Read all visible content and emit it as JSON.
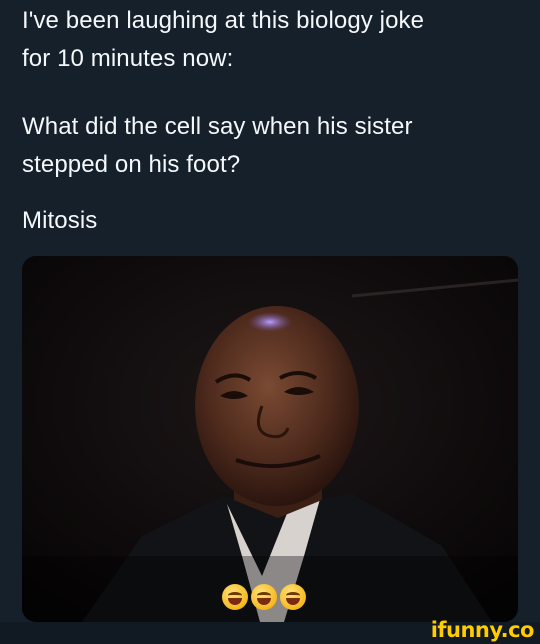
{
  "tweet": {
    "paragraphs": [
      [
        "I've been laughing at this biology joke",
        "for 10 minutes now:"
      ],
      [
        "What did the cell say when his sister",
        "stepped on his foot?"
      ],
      [
        "Mitosis"
      ]
    ]
  },
  "media": {
    "emoji_icon": "face-with-tears-of-joy-icon",
    "emoji_count": 3
  },
  "watermark": {
    "text": "ifunny.co",
    "color": "#ffcc00"
  },
  "colors": {
    "background": "#15202b",
    "text": "#f5f8fa"
  }
}
